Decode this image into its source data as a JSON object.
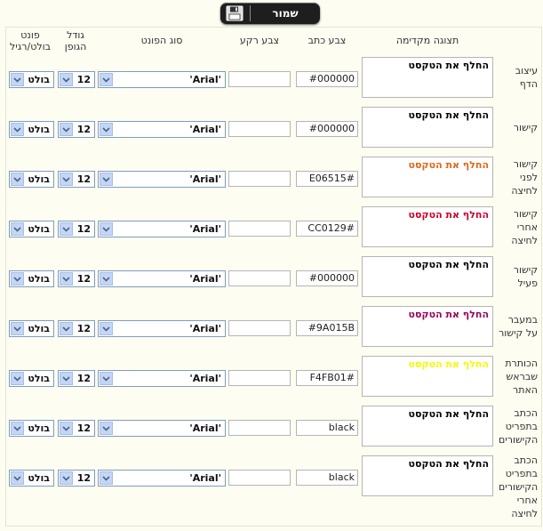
{
  "toolbar": {
    "save_label": "שמור",
    "save_icon": "floppy-disk-icon"
  },
  "headers": {
    "preview": "תצוגה מקדימה",
    "text_color": "צבע כתב",
    "bg_color": "צבע רקע",
    "font_type": "סוג הפונט",
    "font_size": [
      "גודל",
      "הגופן"
    ],
    "font_weight": [
      "פונט",
      "בולט/רגיל"
    ]
  },
  "rows": [
    {
      "label": [
        "עיצוב",
        "הדף"
      ],
      "preview_text": "החלף את הטקסט",
      "preview_color": "#000000",
      "text_color": "#000000",
      "bg_color": "",
      "font": "'Arial'",
      "size": "12",
      "weight": "בולט"
    },
    {
      "label": [
        "קישור"
      ],
      "preview_text": "החלף את הטקסט",
      "preview_color": "#000000",
      "text_color": "#000000",
      "bg_color": "",
      "font": "'Arial'",
      "size": "12",
      "weight": "בולט"
    },
    {
      "label": [
        "קישור",
        "לפני",
        "לחיצה"
      ],
      "preview_text": "החלף את הטקסט",
      "preview_color": "#E06515",
      "text_color": "E06515#",
      "bg_color": "",
      "font": "'Arial'",
      "size": "12",
      "weight": "בולט"
    },
    {
      "label": [
        "קישור",
        "אחרי",
        "לחיצה"
      ],
      "preview_text": "החלף את הטקסט",
      "preview_color": "#CC0129",
      "text_color": "CC0129#",
      "bg_color": "",
      "font": "'Arial'",
      "size": "12",
      "weight": "בולט"
    },
    {
      "label": [
        "קישור",
        "פעיל"
      ],
      "preview_text": "החלף את הטקסט",
      "preview_color": "#000000",
      "text_color": "#000000",
      "bg_color": "",
      "font": "'Arial'",
      "size": "12",
      "weight": "בולט"
    },
    {
      "label": [
        "במעבר",
        "על קישור"
      ],
      "preview_text": "החלף את הטקסט",
      "preview_color": "#9A015B",
      "text_color": "#9A015B",
      "bg_color": "",
      "font": "'Arial'",
      "size": "12",
      "weight": "בולט"
    },
    {
      "label": [
        "הכותרת",
        "שבראש",
        "האתר"
      ],
      "preview_text": "החלף את הטקסט",
      "preview_color": "#F4FB01",
      "text_color": "F4FB01#",
      "bg_color": "",
      "font": "'Arial'",
      "size": "12",
      "weight": "בולט"
    },
    {
      "label": [
        "הכתב",
        "בתפריט",
        "הקישורים"
      ],
      "preview_text": "החלף את הטקסט",
      "preview_color": "#000000",
      "text_color": "black",
      "bg_color": "",
      "font": "'Arial'",
      "size": "12",
      "weight": "בולט"
    },
    {
      "label": [
        "הכתב",
        "בתפריט",
        "הקישורים",
        "אחרי",
        "לחיצה"
      ],
      "preview_text": "החלף את הטקסט",
      "preview_color": "#000000",
      "text_color": "black",
      "bg_color": "",
      "font": "'Arial'",
      "size": "12",
      "weight": "בולט"
    }
  ]
}
